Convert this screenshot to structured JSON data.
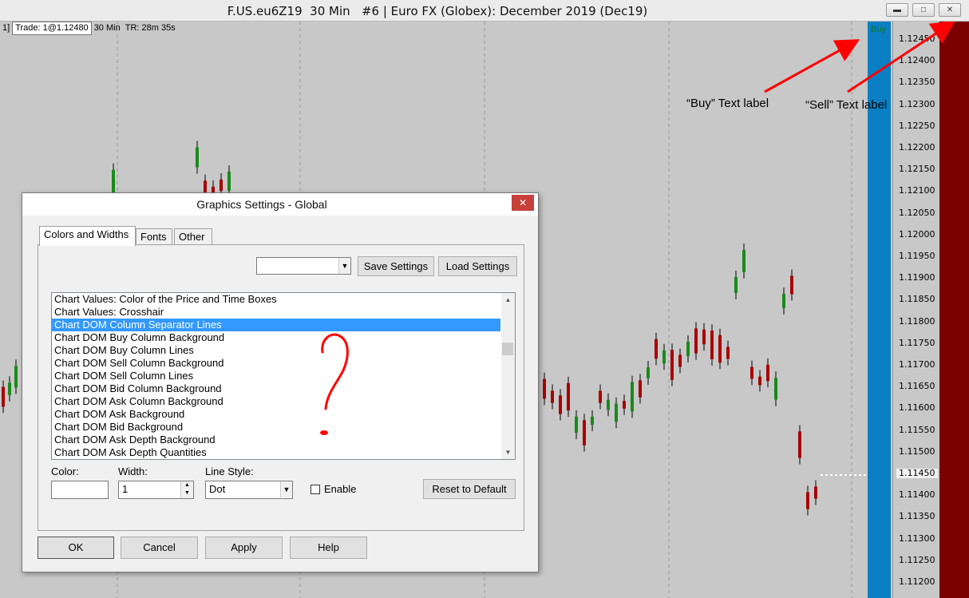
{
  "window": {
    "title": "F.US.eu6Z19  30 Min   #6 | Euro FX (Globex): December 2019 (Dec19)",
    "buttons": [
      "minimize",
      "restore",
      "close"
    ]
  },
  "chart": {
    "info_bar": {
      "prefix": "1]",
      "trade": "Trade: 1@1.12480",
      "interval": "30 Min",
      "timer": "TR: 28m 35s"
    },
    "y_ticks": [
      "1.12450",
      "1.12400",
      "1.12350",
      "1.12300",
      "1.12250",
      "1.12200",
      "1.12150",
      "1.12100",
      "1.12050",
      "1.12000",
      "1.11950",
      "1.11900",
      "1.11850",
      "1.11800",
      "1.11750",
      "1.11700",
      "1.11650",
      "1.11600",
      "1.11550",
      "1.11500",
      "1.11450",
      "1.11400",
      "1.11350",
      "1.11300",
      "1.11250",
      "1.11200"
    ],
    "current_price": "1.11450",
    "buy_label": "Buy",
    "colors": {
      "background": "#c8c8c8",
      "buy_column": "#0a7fc4",
      "sell_column": "#7b0000",
      "up_candle": "#1a8a1a",
      "down_candle": "#a80000",
      "arrow": "#ff0000"
    }
  },
  "annotations": {
    "buy_text": "“Buy” Text label",
    "sell_text": "“Sell” Text label"
  },
  "dialog": {
    "title": "Graphics Settings - Global",
    "close": "✕",
    "tabs": [
      "Colors and Widths",
      "Fonts",
      "Other"
    ],
    "active_tab": "Colors and Widths",
    "preset_select_value": "",
    "save_settings": "Save Settings",
    "load_settings": "Load Settings",
    "list_items": [
      "Chart Values: Color of the Price and Time Boxes",
      "Chart Values: Crosshair",
      "Chart DOM Column Separator Lines",
      "Chart DOM Buy Column Background",
      "Chart DOM Buy Column Lines",
      "Chart DOM Sell Column Background",
      "Chart DOM Sell Column Lines",
      "Chart DOM Bid Column Background",
      "Chart DOM Ask Column Background",
      "Chart DOM Ask Background",
      "Chart DOM Bid Background",
      "Chart DOM Ask Depth Background",
      "Chart DOM Ask Depth Quantities"
    ],
    "selected_index": 2,
    "color_label": "Color:",
    "width_label": "Width:",
    "width_value": "1",
    "line_style_label": "Line Style:",
    "line_style_value": "Dot",
    "enable_label": "Enable",
    "reset_button": "Reset to Default",
    "ok": "OK",
    "cancel": "Cancel",
    "apply": "Apply",
    "help": "Help"
  }
}
